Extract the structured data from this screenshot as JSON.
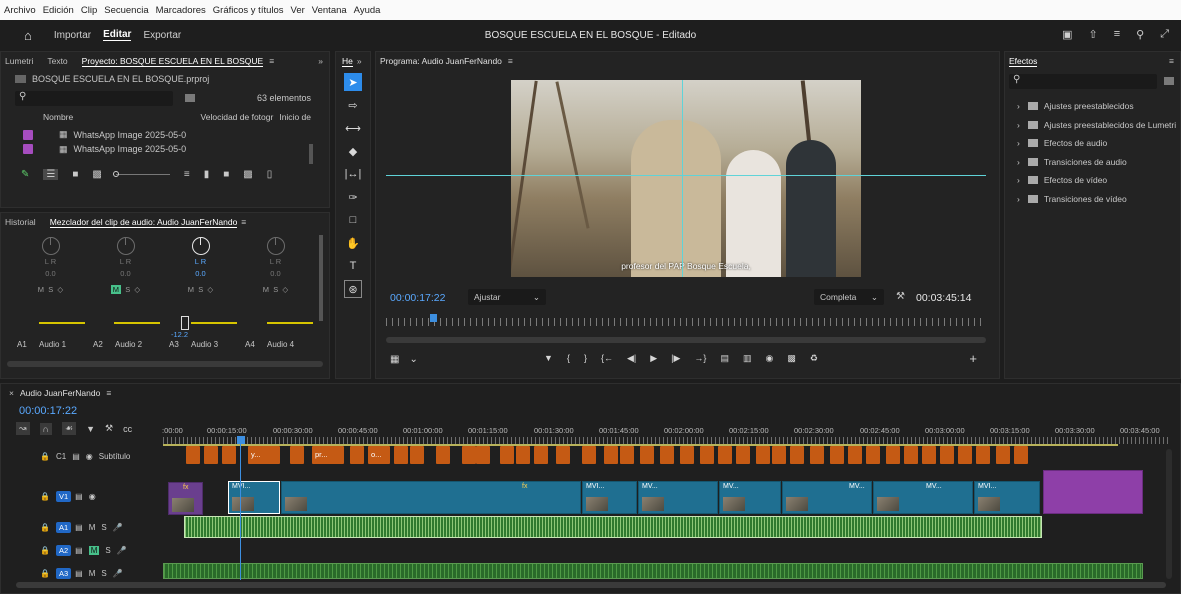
{
  "menu": [
    "Archivo",
    "Edición",
    "Clip",
    "Secuencia",
    "Marcadores",
    "Gráficos y títulos",
    "Ver",
    "Ventana",
    "Ayuda"
  ],
  "header": {
    "nav": [
      "Importar",
      "Editar",
      "Exportar"
    ],
    "active": "Editar",
    "title": "BOSQUE ESCUELA EN EL BOSQUE - Editado"
  },
  "project_panel": {
    "tabs": [
      "Lumetri",
      "Texto",
      "Proyecto: BOSQUE ESCUELA EN EL BOSQUE"
    ],
    "file": "BOSQUE ESCUELA EN EL BOSQUE.prproj",
    "count": "63 elementos",
    "col_name": "Nombre",
    "col_fps": "Velocidad de fotogr",
    "col_start": "Inicio de",
    "items": [
      "WhatsApp Image 2025-05-0",
      "WhatsApp Image 2025-05-0"
    ]
  },
  "mixer": {
    "tabs": [
      "Historial",
      "Mezclador del clip de audio: Audio JuanFerNando"
    ],
    "lr_label": "L R",
    "channels": [
      {
        "id": "A1",
        "name": "Audio 1",
        "value": "0.0"
      },
      {
        "id": "A2",
        "name": "Audio 2",
        "value": "0.0"
      },
      {
        "id": "A3",
        "name": "Audio 3",
        "value": "0.0"
      },
      {
        "id": "A4",
        "name": "Audio 4",
        "value": "0.0"
      }
    ],
    "fader_value": "-12.2",
    "msr": [
      "M",
      "S"
    ]
  },
  "tools_tab": "He",
  "program": {
    "tab": "Programa: Audio JuanFerNando",
    "caption": "profesor del PAP Bosque Escuela,",
    "timecode": "00:00:17:22",
    "fit": "Ajustar",
    "quality": "Completa",
    "duration": "00:03:45:14"
  },
  "effects": {
    "tab": "Efectos",
    "items": [
      "Ajustes preestablecidos",
      "Ajustes preestablecidos de Lumetri",
      "Efectos de audio",
      "Transiciones de audio",
      "Efectos de vídeo",
      "Transiciones de vídeo"
    ]
  },
  "timeline": {
    "tab": "Audio JuanFerNando",
    "timecode": "00:00:17:22",
    "ruler": [
      ":00:00",
      "00:00:15:00",
      "00:00:30:00",
      "00:00:45:00",
      "00:01:00:00",
      "00:01:15:00",
      "00:01:30:00",
      "00:01:45:00",
      "00:02:00:00",
      "00:02:15:00",
      "00:02:30:00",
      "00:02:45:00",
      "00:03:00:00",
      "00:03:15:00",
      "00:03:30:00",
      "00:03:45:00"
    ],
    "tracks": {
      "subtitle": {
        "id": "C1",
        "name": "Subtítulo"
      },
      "video": {
        "id": "V1"
      },
      "audio": [
        "A1",
        "A2",
        "A3"
      ]
    },
    "subtitle_clips": [
      "y...",
      "pr...",
      "o..."
    ],
    "video_clips": [
      "MVI...",
      "MVI...",
      "MV...",
      "MV...",
      "MV...",
      "MV...",
      "MVI..."
    ],
    "fx_label": "fx"
  }
}
